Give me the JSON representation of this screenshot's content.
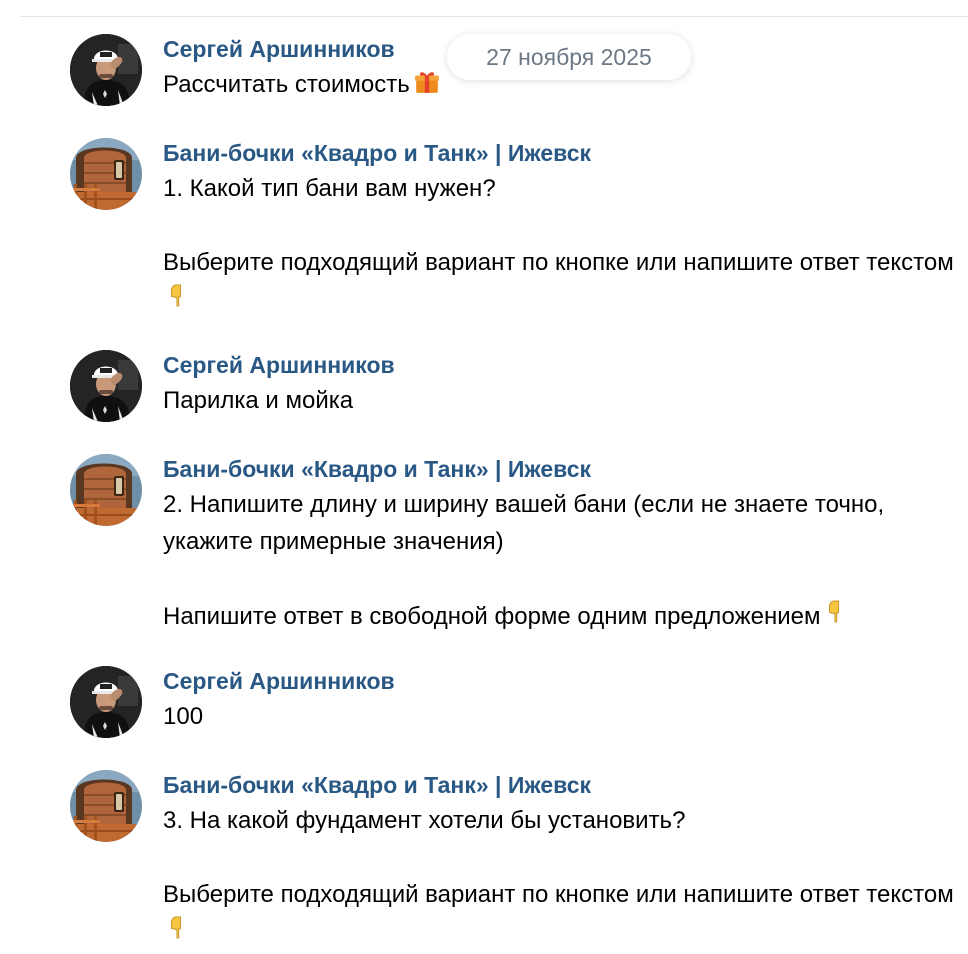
{
  "date_badge": "27 ноября 2025",
  "messages": [
    {
      "author": "Сергей Аршинников",
      "avatar": "user-avatar",
      "lines": [
        "Рассчитать стоимость"
      ],
      "emoji": "gift-icon"
    },
    {
      "author": "Бани-бочки «Квадро и Танк» | Ижевск",
      "avatar": "community-avatar",
      "lines": [
        "1. Какой тип бани вам нужен?",
        "Выберите подходящий вариант по кнопке или напишите ответ текстом"
      ],
      "emoji": "pointing-down-hand-icon"
    },
    {
      "author": "Сергей Аршинников",
      "avatar": "user-avatar",
      "lines": [
        "Парилка и мойка"
      ]
    },
    {
      "author": "Бани-бочки «Квадро и Танк» | Ижевск",
      "avatar": "community-avatar",
      "lines": [
        "2. Напишите длину и ширину вашей бани (если не знаете точно, укажите примерные значения)",
        "Напишите ответ в свободной форме одним предложением"
      ],
      "emoji": "pointing-down-hand-icon"
    },
    {
      "author": "Сергей Аршинников",
      "avatar": "user-avatar",
      "lines": [
        "100"
      ]
    },
    {
      "author": "Бани-бочки «Квадро и Танк» | Ижевск",
      "avatar": "community-avatar",
      "lines": [
        "3. На какой фундамент хотели бы установить?",
        "Выберите подходящий вариант по кнопке или напишите ответ текстом"
      ],
      "emoji": "pointing-down-hand-icon"
    }
  ],
  "colors": {
    "author_link": "#2a5885",
    "message_text": "#000000",
    "date_badge_text": "#6d7885",
    "divider": "#e1e3e6"
  }
}
